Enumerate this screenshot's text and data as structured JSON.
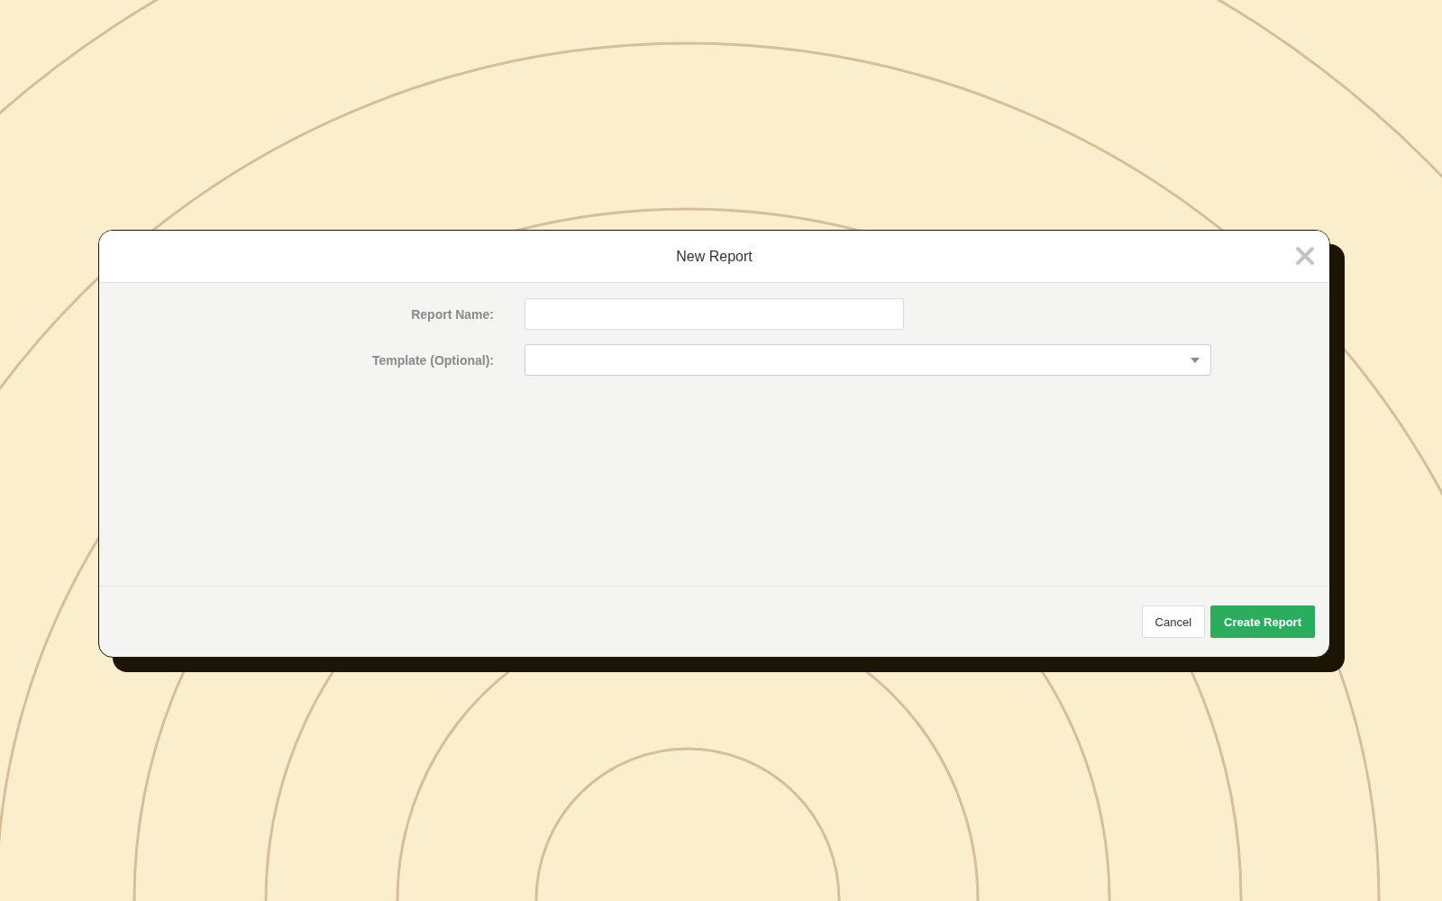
{
  "dialog": {
    "title": "New Report",
    "fields": [
      {
        "label": "Report Name:",
        "kind": "text"
      },
      {
        "label": "Template (Optional):",
        "kind": "select"
      }
    ],
    "buttons": [
      {
        "label": "Cancel",
        "kind": "secondary"
      },
      {
        "label": "Create Report",
        "kind": "primary"
      }
    ]
  }
}
